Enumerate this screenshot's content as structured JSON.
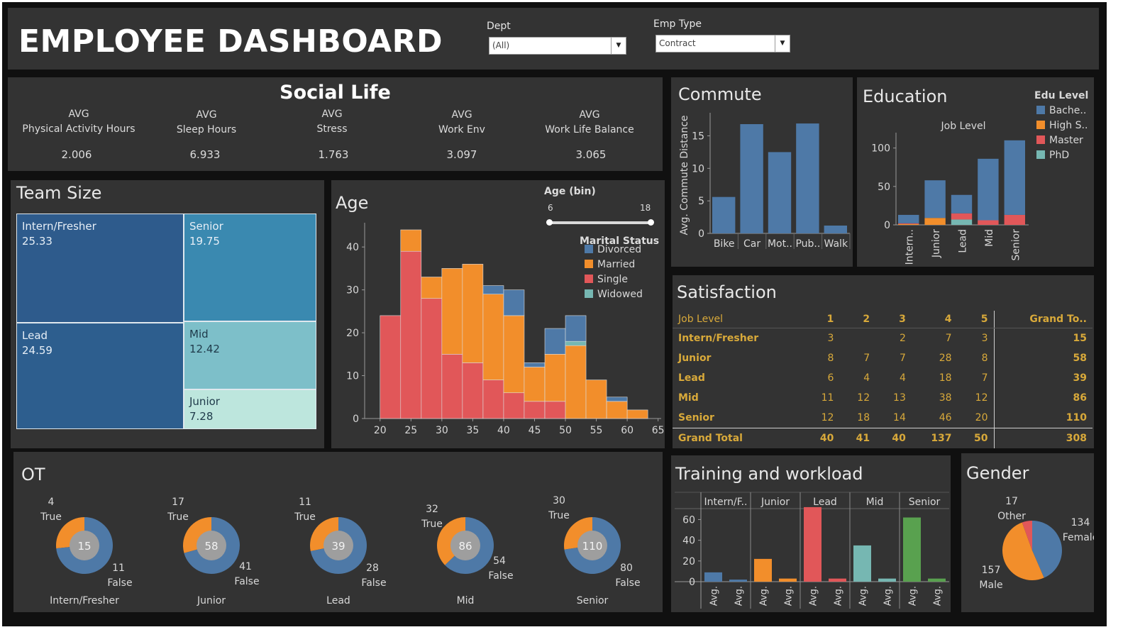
{
  "title": "EMPLOYEE DASHBOARD",
  "filters": {
    "dept": {
      "label": "Dept",
      "value": "(All)"
    },
    "emp_type": {
      "label": "Emp Type",
      "value": "Contract"
    }
  },
  "colors": {
    "blue": "#4e79a7",
    "orange": "#f28e2b",
    "red": "#e15759",
    "teal": "#76b7b2",
    "green": "#59a14f",
    "panel": "#333333",
    "table_text": "#d8a93a"
  },
  "social": {
    "title": "Social Life",
    "kpis": [
      {
        "top": "AVG",
        "label": "Physical Activity Hours",
        "value": "2.006"
      },
      {
        "top": "AVG",
        "label": "Sleep Hours",
        "value": "6.933"
      },
      {
        "top": "AVG",
        "label": "Stress",
        "value": "1.763"
      },
      {
        "top": "AVG",
        "label": "Work Env",
        "value": "3.097"
      },
      {
        "top": "AVG",
        "label": "Work Life Balance",
        "value": "3.065"
      }
    ]
  },
  "team": {
    "title": "Team Size",
    "cells": [
      {
        "name": "Intern/Fresher",
        "value": "25.33"
      },
      {
        "name": "Senior",
        "value": "19.75"
      },
      {
        "name": "Lead",
        "value": "24.59"
      },
      {
        "name": "Mid",
        "value": "12.42"
      },
      {
        "name": "Junior",
        "value": "7.28"
      }
    ]
  },
  "age": {
    "title": "Age",
    "slider_title": "Age (bin)",
    "slider_min": "6",
    "slider_max": "18",
    "legend_title": "Marital Status"
  },
  "commute": {
    "title": "Commute"
  },
  "education": {
    "title": "Education",
    "legend_title": "Edu Level"
  },
  "satisfaction": {
    "title": "Satisfaction",
    "header": [
      "Job Level",
      "1",
      "2",
      "3",
      "4",
      "5",
      "Grand To.."
    ],
    "rows": [
      [
        "Intern/Fresher",
        "3",
        "",
        "2",
        "7",
        "3",
        "15"
      ],
      [
        "Junior",
        "8",
        "7",
        "7",
        "28",
        "8",
        "58"
      ],
      [
        "Lead",
        "6",
        "4",
        "4",
        "18",
        "7",
        "39"
      ],
      [
        "Mid",
        "11",
        "12",
        "13",
        "38",
        "12",
        "86"
      ],
      [
        "Senior",
        "12",
        "18",
        "14",
        "46",
        "20",
        "110"
      ]
    ],
    "total": [
      "Grand Total",
      "40",
      "41",
      "40",
      "137",
      "50",
      "308"
    ]
  },
  "ot": {
    "title": "OT",
    "true_label": "True",
    "false_label": "False",
    "items": [
      {
        "level": "Intern/Fresher",
        "true": 4,
        "false": 11,
        "total": 15
      },
      {
        "level": "Junior",
        "true": 17,
        "false": 41,
        "total": 58
      },
      {
        "level": "Lead",
        "true": 11,
        "false": 28,
        "total": 39
      },
      {
        "level": "Mid",
        "true": 32,
        "false": 54,
        "total": 86
      },
      {
        "level": "Senior",
        "true": 30,
        "false": 80,
        "total": 110
      }
    ]
  },
  "training": {
    "title": "Training and workload"
  },
  "gender": {
    "title": "Gender",
    "slices": [
      {
        "label": "Female",
        "value": 134
      },
      {
        "label": "Male",
        "value": 157
      },
      {
        "label": "Other",
        "value": 17
      }
    ]
  },
  "chart_data": [
    {
      "id": "age",
      "type": "bar",
      "stacked": true,
      "xlabel": "",
      "ylabel": "",
      "x_bins_start": [
        20,
        23.33,
        26.67,
        30,
        33.33,
        36.67,
        40,
        43.33,
        46.67,
        50,
        53.33,
        56.67,
        60
      ],
      "x_ticks": [
        20,
        25,
        30,
        35,
        40,
        45,
        50,
        55,
        60,
        65
      ],
      "xlim": [
        17.5,
        65.5
      ],
      "ylim": [
        0,
        44
      ],
      "y_ticks": [
        0,
        10,
        20,
        30,
        40
      ],
      "series": [
        {
          "name": "Single",
          "color": "#e15759",
          "values": [
            24,
            39,
            28,
            15,
            13,
            9,
            6,
            4,
            4,
            0,
            0,
            0,
            0
          ]
        },
        {
          "name": "Married",
          "color": "#f28e2b",
          "values": [
            0,
            5,
            5,
            20,
            23,
            20,
            18,
            8,
            11,
            17,
            9,
            4,
            2
          ]
        },
        {
          "name": "Widowed",
          "color": "#76b7b2",
          "values": [
            0,
            0,
            0,
            0,
            0,
            0,
            0,
            0,
            0,
            1,
            0,
            0,
            0
          ]
        },
        {
          "name": "Divorced",
          "color": "#4e79a7",
          "values": [
            0,
            0,
            0,
            0,
            0,
            2,
            6,
            1,
            6,
            6,
            0,
            1,
            0
          ]
        }
      ],
      "legend": [
        "Divorced",
        "Married",
        "Single",
        "Widowed"
      ],
      "legend_position": "top-right"
    },
    {
      "id": "commute",
      "type": "bar",
      "ylabel": "Avg. Commute Distance",
      "categories": [
        "Bike",
        "Car",
        "Mot..",
        "Pub..",
        "Walk"
      ],
      "values": [
        5.6,
        16.8,
        12.5,
        16.9,
        1.2
      ],
      "ylim": [
        0,
        18
      ],
      "y_ticks": [
        0,
        5,
        10,
        15
      ]
    },
    {
      "id": "education",
      "type": "bar",
      "stacked": true,
      "title": "Job Level",
      "categories": [
        "Intern..",
        "Junior",
        "Lead",
        "Mid",
        "Senior"
      ],
      "series": [
        {
          "name": "High S..",
          "color": "#f28e2b",
          "values": [
            1,
            9,
            0,
            0,
            0
          ]
        },
        {
          "name": "PhD",
          "color": "#76b7b2",
          "values": [
            0,
            0,
            7,
            0,
            0
          ]
        },
        {
          "name": "Master",
          "color": "#e15759",
          "values": [
            1,
            0,
            8,
            6,
            13
          ]
        },
        {
          "name": "Bache..",
          "color": "#4e79a7",
          "values": [
            11,
            49,
            24,
            80,
            97
          ]
        }
      ],
      "legend": [
        "Bache..",
        "High S..",
        "Master",
        "PhD"
      ],
      "ylim": [
        0,
        120
      ],
      "y_ticks": [
        0,
        50,
        100
      ],
      "legend_position": "top-right"
    },
    {
      "id": "training",
      "type": "bar",
      "groups": [
        "Intern/F..",
        "Junior",
        "Lead",
        "Mid",
        "Senior"
      ],
      "bar_labels": [
        "Avg.",
        "Avg."
      ],
      "values": [
        [
          9,
          2
        ],
        [
          22,
          3
        ],
        [
          72,
          3
        ],
        [
          35,
          3
        ],
        [
          62,
          3
        ]
      ],
      "colors": [
        "#4e79a7",
        "#f28e2b",
        "#e15759",
        "#76b7b2",
        "#59a14f"
      ],
      "ylim": [
        0,
        74
      ],
      "y_ticks": [
        0,
        20,
        40,
        60
      ]
    },
    {
      "id": "ot",
      "type": "pie",
      "donut": true,
      "categories": [
        "Intern/Fresher",
        "Junior",
        "Lead",
        "Mid",
        "Senior"
      ],
      "series": [
        {
          "name": "True",
          "values": [
            4,
            17,
            11,
            32,
            30
          ]
        },
        {
          "name": "False",
          "values": [
            11,
            41,
            28,
            54,
            80
          ]
        }
      ],
      "totals": [
        15,
        58,
        39,
        86,
        110
      ]
    },
    {
      "id": "gender",
      "type": "pie",
      "categories": [
        "Female",
        "Male",
        "Other"
      ],
      "values": [
        134,
        157,
        17
      ]
    }
  ]
}
